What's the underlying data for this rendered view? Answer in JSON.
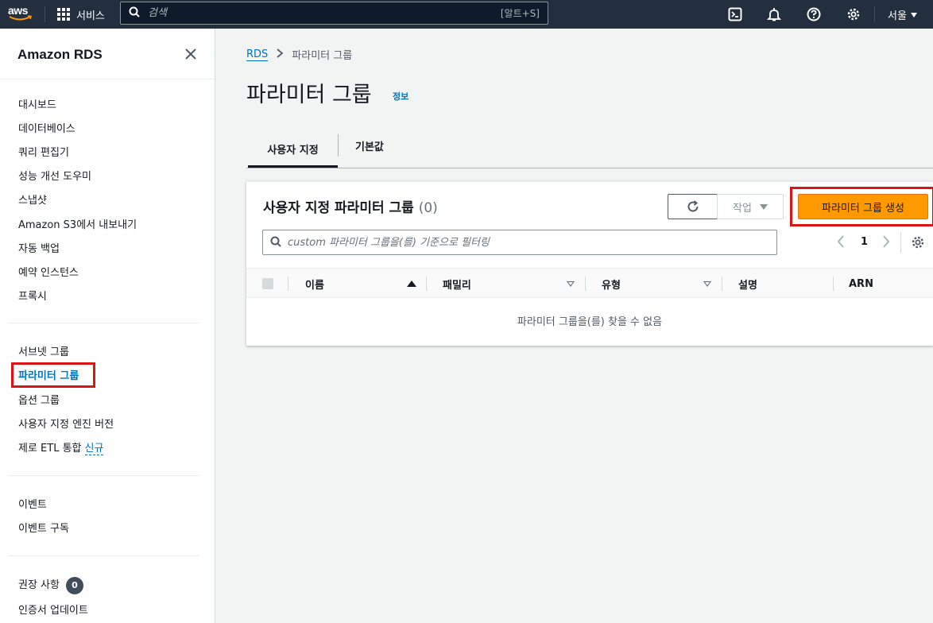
{
  "topbar": {
    "logo_text": "aws",
    "services_label": "서비스",
    "search_placeholder": "검색",
    "search_shortcut": "[알트+S]",
    "region_label": "서울"
  },
  "sidebar": {
    "title": "Amazon RDS",
    "group1": [
      "대시보드",
      "데이터베이스",
      "쿼리 편집기",
      "성능 개선 도우미",
      "스냅샷",
      "Amazon S3에서 내보내기",
      "자동 백업",
      "예약 인스턴스",
      "프록시"
    ],
    "group2": [
      "서브넷 그룹",
      "파라미터 그룹",
      "옵션 그룹",
      "사용자 지정 엔진 버전",
      "제로 ETL 통합"
    ],
    "new_badge": "신규",
    "group3": [
      "이벤트",
      "이벤트 구독"
    ],
    "group4": [
      "권장 사항",
      "인증서 업데이트"
    ],
    "recommendations_count": "0"
  },
  "breadcrumb": {
    "root": "RDS",
    "current": "파라미터 그룹"
  },
  "page": {
    "title": "파라미터 그룹",
    "info_link": "정보"
  },
  "tabs": [
    {
      "label": "사용자 지정",
      "active": true
    },
    {
      "label": "기본값",
      "active": false
    }
  ],
  "panel": {
    "title": "사용자 지정 파라미터 그룹",
    "count": "(0)",
    "actions_label": "작업",
    "create_label": "파라미터 그룹 생성",
    "filter_placeholder": "custom 파라미터 그룹을(를) 기준으로 필터링",
    "page_number": "1",
    "columns": [
      "이름",
      "패밀리",
      "유형",
      "설명",
      "ARN"
    ],
    "empty_message": "파라미터 그룹을(를) 찾을 수 없음"
  },
  "colors": {
    "topbar_bg": "#232f3e",
    "link": "#0073bb",
    "primary_button": "#ff9900",
    "highlight": "#d91515"
  }
}
